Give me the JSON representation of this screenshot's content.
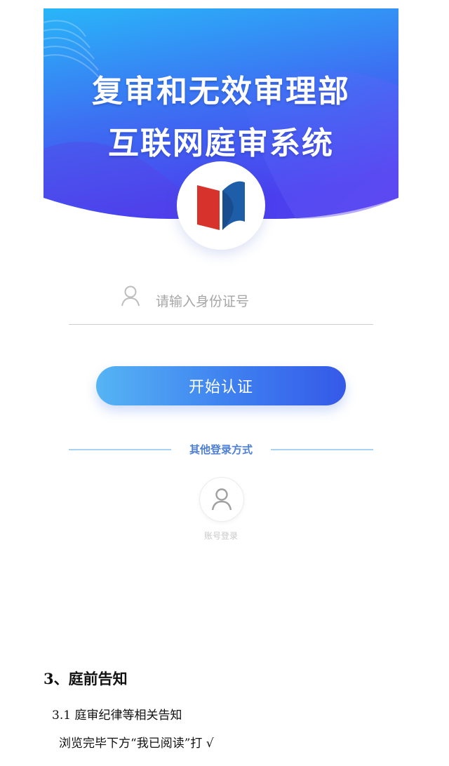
{
  "banner": {
    "title_line1": "复审和无效审理部",
    "title_line2": "互联网庭审系统",
    "colors": {
      "top": "#2ab0f7",
      "bottom": "#4a47ee",
      "accent": "#6a3cf0"
    }
  },
  "logo": {
    "icon": "institution-logo",
    "colors": {
      "red": "#d7322c",
      "blue": "#1e5ea8"
    }
  },
  "login": {
    "id_input": {
      "placeholder": "请输入身份证号",
      "value": "",
      "icon": "user-icon"
    },
    "start_button_label": "开始认证",
    "other_methods_label": "其他登录方式",
    "account_login": {
      "icon": "user-icon",
      "label": "账号登录"
    }
  },
  "document": {
    "heading": "3、庭前告知",
    "subheading": "3.1 庭审纪律等相关告知",
    "instruction": "浏览完毕下方“我已阅读”打 √"
  }
}
